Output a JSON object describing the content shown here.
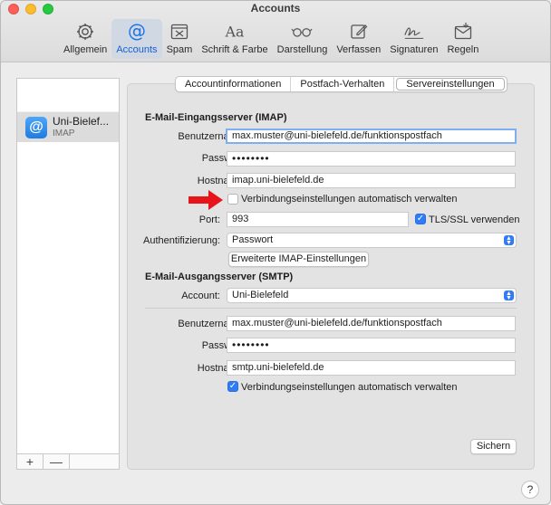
{
  "window": {
    "title": "Accounts",
    "traffic_lights": [
      "#fc5f57",
      "#fdbc2e",
      "#28c840"
    ]
  },
  "toolbar": {
    "items": [
      {
        "label": "Allgemein",
        "icon": "gear-icon"
      },
      {
        "label": "Accounts",
        "icon": "at-icon",
        "active": true
      },
      {
        "label": "Spam",
        "icon": "junk-tray-icon"
      },
      {
        "label": "Schrift & Farbe",
        "icon": "font-icon"
      },
      {
        "label": "Darstellung",
        "icon": "glasses-icon"
      },
      {
        "label": "Verfassen",
        "icon": "compose-icon"
      },
      {
        "label": "Signaturen",
        "icon": "signature-icon"
      },
      {
        "label": "Regeln",
        "icon": "rules-icon"
      }
    ]
  },
  "sidebar": {
    "account_name": "Uni-Bielef...",
    "account_type": "IMAP",
    "add": "+",
    "remove": "—"
  },
  "tabs": [
    "Accountinformationen",
    "Postfach-Verhalten",
    "Servereinstellungen"
  ],
  "incoming": {
    "title": "E-Mail-Eingangsserver (IMAP)",
    "username_label": "Benutzername:",
    "username": "max.muster@uni-bielefeld.de/funktionspostfach",
    "password_label": "Passwort:",
    "password": "••••••••",
    "hostname_label": "Hostname:",
    "hostname": "imap.uni-bielefeld.de",
    "auto_manage": "Verbindungseinstellungen automatisch verwalten",
    "port_label": "Port:",
    "port": "993",
    "tls": "TLS/SSL verwenden",
    "auth_label": "Authentifizierung:",
    "auth": "Passwort",
    "advanced_button": "Erweiterte IMAP-Einstellungen"
  },
  "outgoing": {
    "title": "E-Mail-Ausgangsserver (SMTP)",
    "account_label": "Account:",
    "account": "Uni-Bielefeld",
    "username_label": "Benutzername:",
    "username": "max.muster@uni-bielefeld.de/funktionspostfach",
    "password_label": "Passwort:",
    "password": "••••••••",
    "hostname_label": "Hostname:",
    "hostname": "smtp.uni-bielefeld.de",
    "auto_manage": "Verbindungseinstellungen automatisch verwalten"
  },
  "save_button": "Sichern",
  "help": "?",
  "accent_color": "#2f7cf6",
  "arrow_color": "#e8141b"
}
